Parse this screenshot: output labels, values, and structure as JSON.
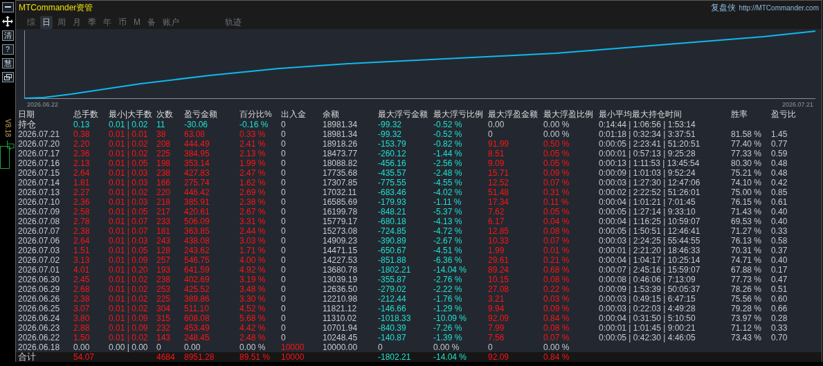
{
  "window": {
    "title": "MTCommander资管",
    "brand": "复盘侠",
    "url": "http://MTCommander.com"
  },
  "sidebar": {
    "buttons": [
      {
        "kind": "minus"
      },
      {
        "kind": "move"
      },
      {
        "kind": "text",
        "label": "清"
      },
      {
        "kind": "text",
        "label": "?"
      },
      {
        "kind": "text",
        "label": "慧"
      },
      {
        "kind": "restore"
      }
    ],
    "version": "V8.18"
  },
  "tabs": [
    {
      "label": "综",
      "selected": false
    },
    {
      "label": "日",
      "selected": true
    },
    {
      "label": "周",
      "selected": false
    },
    {
      "label": "月",
      "selected": false
    },
    {
      "label": "季",
      "selected": false
    },
    {
      "label": "年",
      "selected": false
    },
    {
      "label": "币",
      "selected": false
    },
    {
      "label": "M",
      "selected": false
    },
    {
      "label": "备",
      "selected": false
    },
    {
      "label": "账户",
      "selected": false
    }
  ],
  "side_tabs": [
    {
      "label": "轨迹",
      "selected": false
    }
  ],
  "chart": {
    "start_label": "2026.06.22",
    "end_label": "2026.07.21"
  },
  "table": {
    "columns": [
      "日期",
      "总手数",
      "最小|大手数",
      "次数",
      "盈亏金额",
      "百分比%",
      "出入金",
      "余额",
      "最大浮亏金额",
      "最大浮亏比例",
      "最大浮盈金额",
      "最大浮盈比例",
      "最小平均最大持仓时间",
      "胜率",
      "盈亏比"
    ],
    "rows": [
      {
        "kind": "position",
        "cells": [
          "持仓",
          {
            "text": "0.13",
            "color": "#1ee0d2"
          },
          {
            "text": "0.01 | 0.02",
            "color": "#1ee0d2"
          },
          {
            "text": "11",
            "color": "#1ee0d2"
          },
          {
            "text": "-30.06",
            "color": "#1ee0d2"
          },
          {
            "text": "-0.16 %",
            "color": "#1ee0d2"
          },
          "0",
          "18981.34",
          {
            "text": "-99.32",
            "color": "#1ee0d2"
          },
          {
            "text": "-0.52 %",
            "color": "#1ee0d2"
          },
          "0.00",
          "0.00 %",
          "0:14:44 | 1:06:56 | 1:53:14"
        ]
      },
      {
        "kind": "day",
        "cells": [
          "2026.07.21",
          {
            "text": "0.38",
            "color": "#ff1414"
          },
          {
            "text": "0.01 | 0.01",
            "color": "#ff1414"
          },
          {
            "text": "38",
            "color": "#ff1414"
          },
          {
            "text": "63.08",
            "color": "#ff1414"
          },
          {
            "text": "0.33 %",
            "color": "#ff1414"
          },
          "0",
          "18981.34",
          {
            "text": "-99.32",
            "color": "#1ee0d2"
          },
          {
            "text": "-0.52 %",
            "color": "#1ee0d2"
          },
          "0",
          "0.00 %",
          "0:01:18 | 0:32:34 | 3:37:51",
          "81.58 %",
          "1.45"
        ]
      },
      {
        "kind": "day",
        "cells": [
          "2026.07.20",
          {
            "text": "2.20",
            "color": "#ff1414"
          },
          {
            "text": "0.01 | 0.02",
            "color": "#ff1414"
          },
          {
            "text": "208",
            "color": "#ff1414"
          },
          {
            "text": "444.49",
            "color": "#ff1414"
          },
          {
            "text": "2.41 %",
            "color": "#ff1414"
          },
          "0",
          "18918.26",
          {
            "text": "-153.79",
            "color": "#1ee0d2"
          },
          {
            "text": "-0.82 %",
            "color": "#1ee0d2"
          },
          {
            "text": "91.99",
            "color": "#ff1414"
          },
          {
            "text": "0.50 %",
            "color": "#ff1414"
          },
          "0:00:05 | 2:23:41 | 51:20:51",
          "77.40 %",
          "0.77"
        ]
      },
      {
        "kind": "day",
        "cells": [
          "2026.07.17",
          {
            "text": "2.36",
            "color": "#ff1414"
          },
          {
            "text": "0.01 | 0.02",
            "color": "#ff1414"
          },
          {
            "text": "225",
            "color": "#ff1414"
          },
          {
            "text": "384.95",
            "color": "#ff1414"
          },
          {
            "text": "2.13 %",
            "color": "#ff1414"
          },
          "0",
          "18473.77",
          {
            "text": "-260.12",
            "color": "#1ee0d2"
          },
          {
            "text": "-1.44 %",
            "color": "#1ee0d2"
          },
          {
            "text": "8.51",
            "color": "#ff1414"
          },
          {
            "text": "0.05 %",
            "color": "#ff1414"
          },
          "0:00:01 | 0:57:13 | 9:25:28",
          "77.33 %",
          "0.59"
        ]
      },
      {
        "kind": "day",
        "cells": [
          "2026.07.16",
          {
            "text": "2.13",
            "color": "#ff1414"
          },
          {
            "text": "0.01 | 0.05",
            "color": "#ff1414"
          },
          {
            "text": "198",
            "color": "#ff1414"
          },
          {
            "text": "353.14",
            "color": "#ff1414"
          },
          {
            "text": "1.99 %",
            "color": "#ff1414"
          },
          "0",
          "18088.82",
          {
            "text": "-456.16",
            "color": "#1ee0d2"
          },
          {
            "text": "-2.56 %",
            "color": "#1ee0d2"
          },
          {
            "text": "9.09",
            "color": "#ff1414"
          },
          {
            "text": "0.05 %",
            "color": "#ff1414"
          },
          "0:00:13 | 1:11:53 | 13:45:54",
          "80.30 %",
          "0.48"
        ]
      },
      {
        "kind": "day",
        "cells": [
          "2026.07.15",
          {
            "text": "2.64",
            "color": "#ff1414"
          },
          {
            "text": "0.01 | 0.03",
            "color": "#ff1414"
          },
          {
            "text": "238",
            "color": "#ff1414"
          },
          {
            "text": "427.83",
            "color": "#ff1414"
          },
          {
            "text": "2.47 %",
            "color": "#ff1414"
          },
          "0",
          "17735.68",
          {
            "text": "-435.57",
            "color": "#1ee0d2"
          },
          {
            "text": "-2.48 %",
            "color": "#1ee0d2"
          },
          {
            "text": "15.71",
            "color": "#ff1414"
          },
          {
            "text": "0.09 %",
            "color": "#ff1414"
          },
          "0:00:09 | 1:01:03 | 9:52:24",
          "75.21 %",
          "0.48"
        ]
      },
      {
        "kind": "day",
        "cells": [
          "2026.07.14",
          {
            "text": "1.81",
            "color": "#ff1414"
          },
          {
            "text": "0.01 | 0.03",
            "color": "#ff1414"
          },
          {
            "text": "166",
            "color": "#ff1414"
          },
          {
            "text": "275.74",
            "color": "#ff1414"
          },
          {
            "text": "1.62 %",
            "color": "#ff1414"
          },
          "0",
          "17307.85",
          {
            "text": "-775.55",
            "color": "#1ee0d2"
          },
          {
            "text": "-4.55 %",
            "color": "#1ee0d2"
          },
          {
            "text": "12.52",
            "color": "#ff1414"
          },
          {
            "text": "0.07 %",
            "color": "#ff1414"
          },
          "0:00:03 | 1:27:30 | 12:47:06",
          "74.10 %",
          "0.42"
        ]
      },
      {
        "kind": "day",
        "cells": [
          "2026.07.13",
          {
            "text": "2.27",
            "color": "#ff1414"
          },
          {
            "text": "0.01 | 0.02",
            "color": "#ff1414"
          },
          {
            "text": "220",
            "color": "#ff1414"
          },
          {
            "text": "446.42",
            "color": "#ff1414"
          },
          {
            "text": "2.69 %",
            "color": "#ff1414"
          },
          "0",
          "17032.11",
          {
            "text": "-683.46",
            "color": "#1ee0d2"
          },
          {
            "text": "-4.02 %",
            "color": "#1ee0d2"
          },
          {
            "text": "51.48",
            "color": "#ff1414"
          },
          {
            "text": "0.31 %",
            "color": "#ff1414"
          },
          "0:00:02 | 2:22:52 | 51:26:01",
          "75.00 %",
          "0.85"
        ]
      },
      {
        "kind": "day",
        "cells": [
          "2026.07.10",
          {
            "text": "2.36",
            "color": "#ff1414"
          },
          {
            "text": "0.01 | 0.03",
            "color": "#ff1414"
          },
          {
            "text": "218",
            "color": "#ff1414"
          },
          {
            "text": "385.91",
            "color": "#ff1414"
          },
          {
            "text": "2.38 %",
            "color": "#ff1414"
          },
          "0",
          "16585.69",
          {
            "text": "-179.93",
            "color": "#1ee0d2"
          },
          {
            "text": "-1.11 %",
            "color": "#1ee0d2"
          },
          {
            "text": "17.34",
            "color": "#ff1414"
          },
          {
            "text": "0.11 %",
            "color": "#ff1414"
          },
          "0:00:04 | 1:01:21 | 7:01:45",
          "76.15 %",
          "0.61"
        ]
      },
      {
        "kind": "day",
        "cells": [
          "2026.07.09",
          {
            "text": "2.58",
            "color": "#ff1414"
          },
          {
            "text": "0.01 | 0.05",
            "color": "#ff1414"
          },
          {
            "text": "217",
            "color": "#ff1414"
          },
          {
            "text": "420.61",
            "color": "#ff1414"
          },
          {
            "text": "2.67 %",
            "color": "#ff1414"
          },
          "0",
          "16199.78",
          {
            "text": "-848.21",
            "color": "#1ee0d2"
          },
          {
            "text": "-5.37 %",
            "color": "#1ee0d2"
          },
          {
            "text": "7.62",
            "color": "#ff1414"
          },
          {
            "text": "0.05 %",
            "color": "#ff1414"
          },
          "0:00:05 | 1:27:14 | 9:33:10",
          "71.43 %",
          "0.40"
        ]
      },
      {
        "kind": "day",
        "cells": [
          "2026.07.08",
          {
            "text": "2.78",
            "color": "#ff1414"
          },
          {
            "text": "0.01 | 0.07",
            "color": "#ff1414"
          },
          {
            "text": "233",
            "color": "#ff1414"
          },
          {
            "text": "506.09",
            "color": "#ff1414"
          },
          {
            "text": "3.31 %",
            "color": "#ff1414"
          },
          "0",
          "15779.17",
          {
            "text": "-680.18",
            "color": "#1ee0d2"
          },
          {
            "text": "-4.13 %",
            "color": "#1ee0d2"
          },
          {
            "text": "6.17",
            "color": "#ff1414"
          },
          {
            "text": "0.04 %",
            "color": "#ff1414"
          },
          "0:00:04 | 1:16:25 | 10:59:07",
          "69.53 %",
          "0.40"
        ]
      },
      {
        "kind": "day",
        "cells": [
          "2026.07.07",
          {
            "text": "2.38",
            "color": "#ff1414"
          },
          {
            "text": "0.01 | 0.07",
            "color": "#ff1414"
          },
          {
            "text": "181",
            "color": "#ff1414"
          },
          {
            "text": "363.85",
            "color": "#ff1414"
          },
          {
            "text": "2.44 %",
            "color": "#ff1414"
          },
          "0",
          "15273.08",
          {
            "text": "-724.85",
            "color": "#1ee0d2"
          },
          {
            "text": "-4.72 %",
            "color": "#1ee0d2"
          },
          {
            "text": "12.85",
            "color": "#ff1414"
          },
          {
            "text": "0.08 %",
            "color": "#ff1414"
          },
          "0:00:05 | 1:50:51 | 12:46:41",
          "71.27 %",
          "0.33"
        ]
      },
      {
        "kind": "day",
        "cells": [
          "2026.07.06",
          {
            "text": "2.64",
            "color": "#ff1414"
          },
          {
            "text": "0.01 | 0.03",
            "color": "#ff1414"
          },
          {
            "text": "243",
            "color": "#ff1414"
          },
          {
            "text": "438.08",
            "color": "#ff1414"
          },
          {
            "text": "3.03 %",
            "color": "#ff1414"
          },
          "0",
          "14909.23",
          {
            "text": "-390.89",
            "color": "#1ee0d2"
          },
          {
            "text": "-2.67 %",
            "color": "#1ee0d2"
          },
          {
            "text": "10.33",
            "color": "#ff1414"
          },
          {
            "text": "0.07 %",
            "color": "#ff1414"
          },
          "0:00:03 | 2:24:25 | 55:44:55",
          "76.13 %",
          "0.58"
        ]
      },
      {
        "kind": "day",
        "cells": [
          "2026.07.03",
          {
            "text": "1.51",
            "color": "#ff1414"
          },
          {
            "text": "0.01 | 0.05",
            "color": "#ff1414"
          },
          {
            "text": "128",
            "color": "#ff1414"
          },
          {
            "text": "243.62",
            "color": "#ff1414"
          },
          {
            "text": "1.71 %",
            "color": "#ff1414"
          },
          "0",
          "14471.15",
          {
            "text": "-650.67",
            "color": "#1ee0d2"
          },
          {
            "text": "-4.51 %",
            "color": "#1ee0d2"
          },
          {
            "text": "1.99",
            "color": "#ff1414"
          },
          {
            "text": "0.01 %",
            "color": "#ff1414"
          },
          "0:00:01 | 2:21:20 | 18:46:33",
          "70.31 %",
          "0.37"
        ]
      },
      {
        "kind": "day",
        "cells": [
          "2026.07.02",
          {
            "text": "3.13",
            "color": "#ff1414"
          },
          {
            "text": "0.01 | 0.09",
            "color": "#ff1414"
          },
          {
            "text": "257",
            "color": "#ff1414"
          },
          {
            "text": "546.75",
            "color": "#ff1414"
          },
          {
            "text": "4.00 %",
            "color": "#ff1414"
          },
          "0",
          "14227.53",
          {
            "text": "-851.88",
            "color": "#1ee0d2"
          },
          {
            "text": "-6.36 %",
            "color": "#1ee0d2"
          },
          {
            "text": "29.61",
            "color": "#ff1414"
          },
          {
            "text": "0.21 %",
            "color": "#ff1414"
          },
          "0:00:04 | 1:04:17 | 10:25:14",
          "74.71 %",
          "0.40"
        ]
      },
      {
        "kind": "day",
        "cells": [
          "2026.07.01",
          {
            "text": "4.01",
            "color": "#ff1414"
          },
          {
            "text": "0.01 | 0.20",
            "color": "#ff1414"
          },
          {
            "text": "193",
            "color": "#ff1414"
          },
          {
            "text": "641.59",
            "color": "#ff1414"
          },
          {
            "text": "4.92 %",
            "color": "#ff1414"
          },
          "0",
          "13680.78",
          {
            "text": "-1802.21",
            "color": "#1ee0d2"
          },
          {
            "text": "-14.04 %",
            "color": "#1ee0d2"
          },
          {
            "text": "89.24",
            "color": "#ff1414"
          },
          {
            "text": "0.68 %",
            "color": "#ff1414"
          },
          "0:00:07 | 2:45:16 | 15:59:07",
          "67.88 %",
          "0.17"
        ]
      },
      {
        "kind": "day",
        "cells": [
          "2026.06.30",
          {
            "text": "2.45",
            "color": "#ff1414"
          },
          {
            "text": "0.01 | 0.02",
            "color": "#ff1414"
          },
          {
            "text": "238",
            "color": "#ff1414"
          },
          {
            "text": "402.69",
            "color": "#ff1414"
          },
          {
            "text": "3.19 %",
            "color": "#ff1414"
          },
          "0",
          "13039.19",
          {
            "text": "-355.87",
            "color": "#1ee0d2"
          },
          {
            "text": "-2.76 %",
            "color": "#1ee0d2"
          },
          {
            "text": "10.15",
            "color": "#ff1414"
          },
          {
            "text": "0.08 %",
            "color": "#ff1414"
          },
          "0:00:08 | 0:46:06 | 7:13:09",
          "77.73 %",
          "0.47"
        ]
      },
      {
        "kind": "day",
        "cells": [
          "2026.06.29",
          {
            "text": "2.68",
            "color": "#ff1414"
          },
          {
            "text": "0.01 | 0.02",
            "color": "#ff1414"
          },
          {
            "text": "253",
            "color": "#ff1414"
          },
          {
            "text": "425.52",
            "color": "#ff1414"
          },
          {
            "text": "3.48 %",
            "color": "#ff1414"
          },
          "0",
          "12636.50",
          {
            "text": "-279.02",
            "color": "#1ee0d2"
          },
          {
            "text": "-2.22 %",
            "color": "#1ee0d2"
          },
          {
            "text": "27.08",
            "color": "#ff1414"
          },
          {
            "text": "0.22 %",
            "color": "#ff1414"
          },
          "0:00:09 | 1:53:39 | 50:05:37",
          "78.26 %",
          "0.51"
        ]
      },
      {
        "kind": "day",
        "cells": [
          "2026.06.26",
          {
            "text": "2.38",
            "color": "#ff1414"
          },
          {
            "text": "0.01 | 0.02",
            "color": "#ff1414"
          },
          {
            "text": "225",
            "color": "#ff1414"
          },
          {
            "text": "389.86",
            "color": "#ff1414"
          },
          {
            "text": "3.30 %",
            "color": "#ff1414"
          },
          "0",
          "12210.98",
          {
            "text": "-212.44",
            "color": "#1ee0d2"
          },
          {
            "text": "-1.76 %",
            "color": "#1ee0d2"
          },
          {
            "text": "3.21",
            "color": "#ff1414"
          },
          {
            "text": "0.03 %",
            "color": "#ff1414"
          },
          "0:00:03 | 0:49:15 | 6:47:15",
          "75.56 %",
          "0.60"
        ]
      },
      {
        "kind": "day",
        "cells": [
          "2026.06.25",
          {
            "text": "3.07",
            "color": "#ff1414"
          },
          {
            "text": "0.01 | 0.02",
            "color": "#ff1414"
          },
          {
            "text": "304",
            "color": "#ff1414"
          },
          {
            "text": "511.10",
            "color": "#ff1414"
          },
          {
            "text": "4.52 %",
            "color": "#ff1414"
          },
          "0",
          "11821.12",
          {
            "text": "-146.66",
            "color": "#1ee0d2"
          },
          {
            "text": "-1.29 %",
            "color": "#1ee0d2"
          },
          {
            "text": "9.94",
            "color": "#ff1414"
          },
          {
            "text": "0.09 %",
            "color": "#ff1414"
          },
          "0:00:03 | 0:22:03 | 4:49:28",
          "79.28 %",
          "0.66"
        ]
      },
      {
        "kind": "day",
        "cells": [
          "2026.06.24",
          {
            "text": "3.80",
            "color": "#ff1414"
          },
          {
            "text": "0.01 | 0.09",
            "color": "#ff1414"
          },
          {
            "text": "315",
            "color": "#ff1414"
          },
          {
            "text": "608.08",
            "color": "#ff1414"
          },
          {
            "text": "5.68 %",
            "color": "#ff1414"
          },
          "0",
          "11310.02",
          {
            "text": "-1018.33",
            "color": "#1ee0d2"
          },
          {
            "text": "-10.09 %",
            "color": "#1ee0d2"
          },
          {
            "text": "92.09",
            "color": "#ff1414"
          },
          {
            "text": "0.84 %",
            "color": "#ff1414"
          },
          "0:00:04 | 0:31:50 | 5:10:50",
          "73.97 %",
          "0.28"
        ]
      },
      {
        "kind": "day",
        "cells": [
          "2026.06.23",
          {
            "text": "2.88",
            "color": "#ff1414"
          },
          {
            "text": "0.01 | 0.09",
            "color": "#ff1414"
          },
          {
            "text": "232",
            "color": "#ff1414"
          },
          {
            "text": "453.49",
            "color": "#ff1414"
          },
          {
            "text": "4.42 %",
            "color": "#ff1414"
          },
          "0",
          "10701.94",
          {
            "text": "-840.39",
            "color": "#1ee0d2"
          },
          {
            "text": "-7.26 %",
            "color": "#1ee0d2"
          },
          {
            "text": "7.99",
            "color": "#ff1414"
          },
          {
            "text": "0.08 %",
            "color": "#ff1414"
          },
          "0:00:01 | 1:01:45 | 9:00:21",
          "71.12 %",
          "0.33"
        ]
      },
      {
        "kind": "day",
        "cells": [
          "2026.06.22",
          {
            "text": "1.50",
            "color": "#ff1414"
          },
          {
            "text": "0.01 | 0.02",
            "color": "#ff1414"
          },
          {
            "text": "143",
            "color": "#ff1414"
          },
          {
            "text": "248.45",
            "color": "#ff1414"
          },
          {
            "text": "2.48 %",
            "color": "#ff1414"
          },
          "0",
          "10248.45",
          {
            "text": "-140.87",
            "color": "#1ee0d2"
          },
          {
            "text": "-1.39 %",
            "color": "#1ee0d2"
          },
          {
            "text": "7.56",
            "color": "#ff1414"
          },
          {
            "text": "0.07 %",
            "color": "#ff1414"
          },
          "0:00:05 | 0:42:30 | 4:46:05",
          "73.43 %",
          "0.70"
        ]
      },
      {
        "kind": "day",
        "cells": [
          "2026.06.18",
          "0.00",
          "0.00 | 0.00",
          "0",
          "0.00",
          "0.00 %",
          {
            "text": "10000",
            "color": "#ff1414"
          },
          "10000.00",
          "0",
          "0.00 %",
          "0",
          "0.00 %"
        ]
      },
      {
        "kind": "total",
        "cells": [
          "合计",
          {
            "text": "54.07",
            "color": "#ff1414"
          },
          null,
          {
            "text": "4684",
            "color": "#ff1414"
          },
          {
            "text": "8951.28",
            "color": "#ff1414"
          },
          {
            "text": "89.51 %",
            "color": "#ff1414"
          },
          {
            "text": "10000",
            "color": "#ff1414"
          },
          null,
          {
            "text": "-1802.21",
            "color": "#1ee0d2"
          },
          {
            "text": "-14.04 %",
            "color": "#1ee0d2"
          },
          {
            "text": "92.09",
            "color": "#ff1414"
          },
          {
            "text": "0.84 %",
            "color": "#ff1414"
          }
        ]
      }
    ]
  }
}
